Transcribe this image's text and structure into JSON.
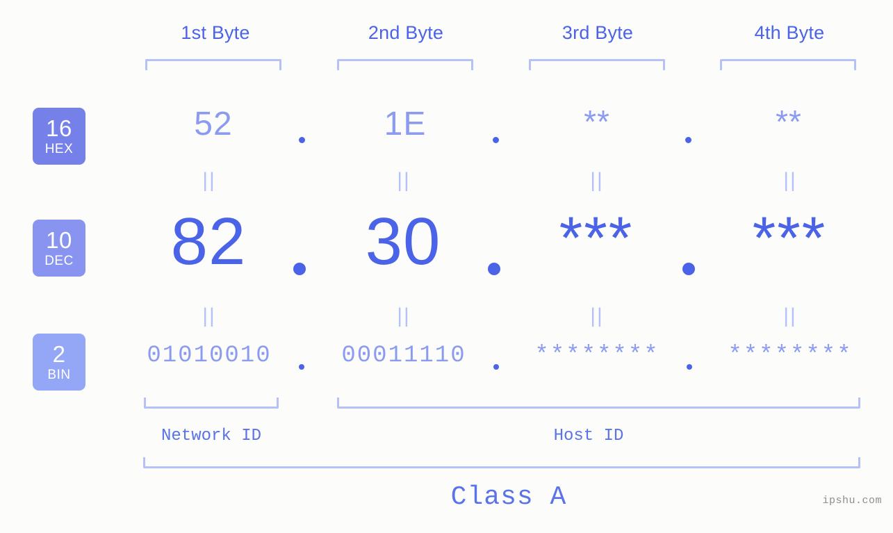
{
  "diagram": {
    "title_class": "Class A",
    "watermark": "ipshu.com",
    "byte_headers": [
      {
        "label": "1st Byte"
      },
      {
        "label": "2nd Byte"
      },
      {
        "label": "3rd Byte"
      },
      {
        "label": "4th Byte"
      }
    ],
    "bases": [
      {
        "num": "16",
        "label": "HEX",
        "color": "#7580e8"
      },
      {
        "num": "10",
        "label": "DEC",
        "color": "#8894f0"
      },
      {
        "num": "2",
        "label": "BIN",
        "color": "#93a7f6"
      }
    ],
    "rows": {
      "hex": {
        "values": [
          "52",
          "1E",
          "**",
          "**"
        ]
      },
      "dec": {
        "values": [
          "82",
          "30",
          "***",
          "***"
        ]
      },
      "bin": {
        "values": [
          "01010010",
          "00011110",
          "********",
          "********"
        ]
      }
    },
    "separator": ".",
    "equality_mark": "||",
    "segments": [
      {
        "label": "Network ID"
      },
      {
        "label": "Host ID"
      }
    ],
    "colors": {
      "background": "#fcfdfb",
      "accent_strong": "#4a63e7",
      "accent_mid": "#8b9bf0",
      "accent_light": "#b6c2f7",
      "watermark": "#8d8d8d"
    }
  }
}
